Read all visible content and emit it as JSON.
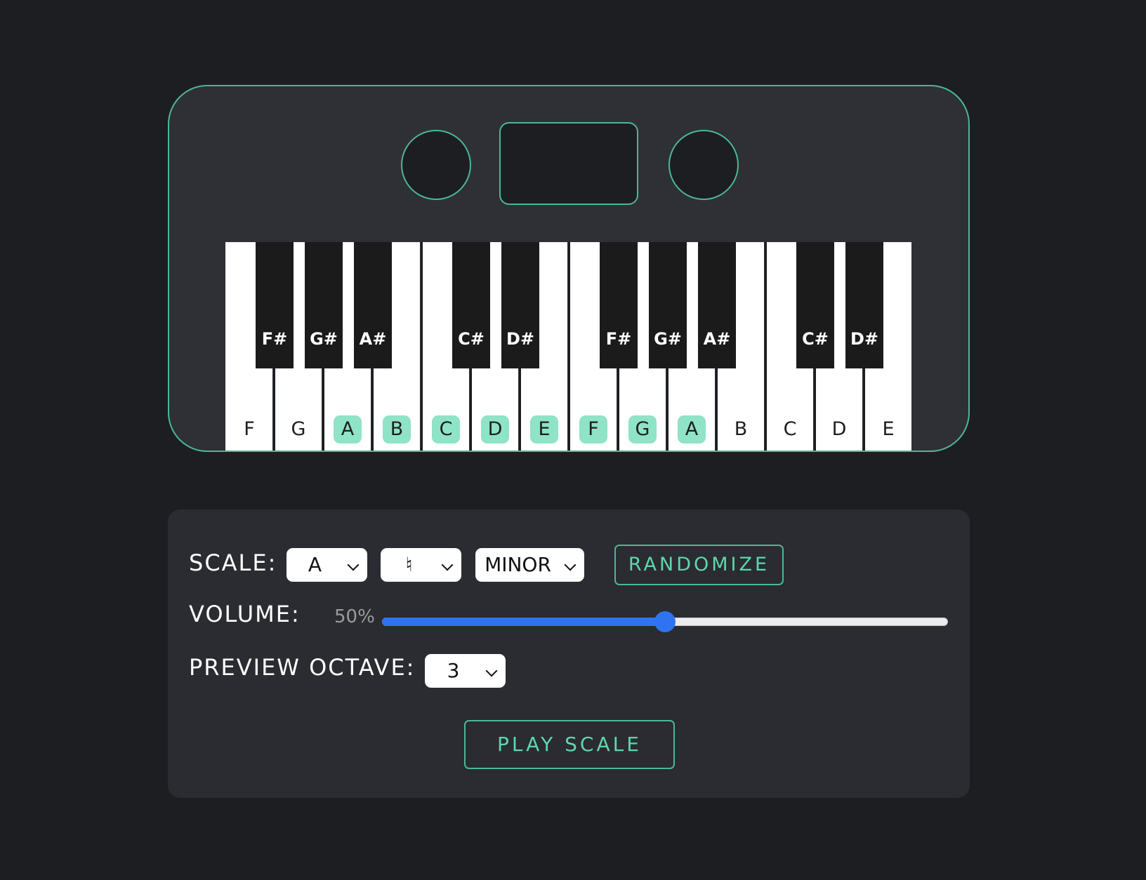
{
  "colors": {
    "accent": "#4bb894",
    "highlight": "#8fe3c7",
    "slider": "#2f73f0",
    "background": "#1d1e22"
  },
  "keyboard": {
    "white_keys": [
      {
        "note": "F",
        "in_scale": false
      },
      {
        "note": "G",
        "in_scale": false
      },
      {
        "note": "A",
        "in_scale": true
      },
      {
        "note": "B",
        "in_scale": true
      },
      {
        "note": "C",
        "in_scale": true
      },
      {
        "note": "D",
        "in_scale": true
      },
      {
        "note": "E",
        "in_scale": true
      },
      {
        "note": "F",
        "in_scale": true
      },
      {
        "note": "G",
        "in_scale": true
      },
      {
        "note": "A",
        "in_scale": true
      },
      {
        "note": "B",
        "in_scale": false
      },
      {
        "note": "C",
        "in_scale": false
      },
      {
        "note": "D",
        "in_scale": false
      },
      {
        "note": "E",
        "in_scale": false
      }
    ],
    "black_keys": [
      "F#",
      "G#",
      "A#",
      "C#",
      "D#",
      "F#",
      "G#",
      "A#",
      "C#",
      "D#"
    ]
  },
  "controls": {
    "scale_label": "SCALE:",
    "scale_note": "A",
    "scale_accidental": "♮",
    "scale_mode": "MINOR",
    "randomize_label": "RANDOMIZE",
    "volume_label": "VOLUME:",
    "volume_readout": "50%",
    "volume_value": 0.5,
    "octave_label": "PREVIEW OCTAVE:",
    "octave_value": "3",
    "play_label": "PLAY SCALE"
  }
}
